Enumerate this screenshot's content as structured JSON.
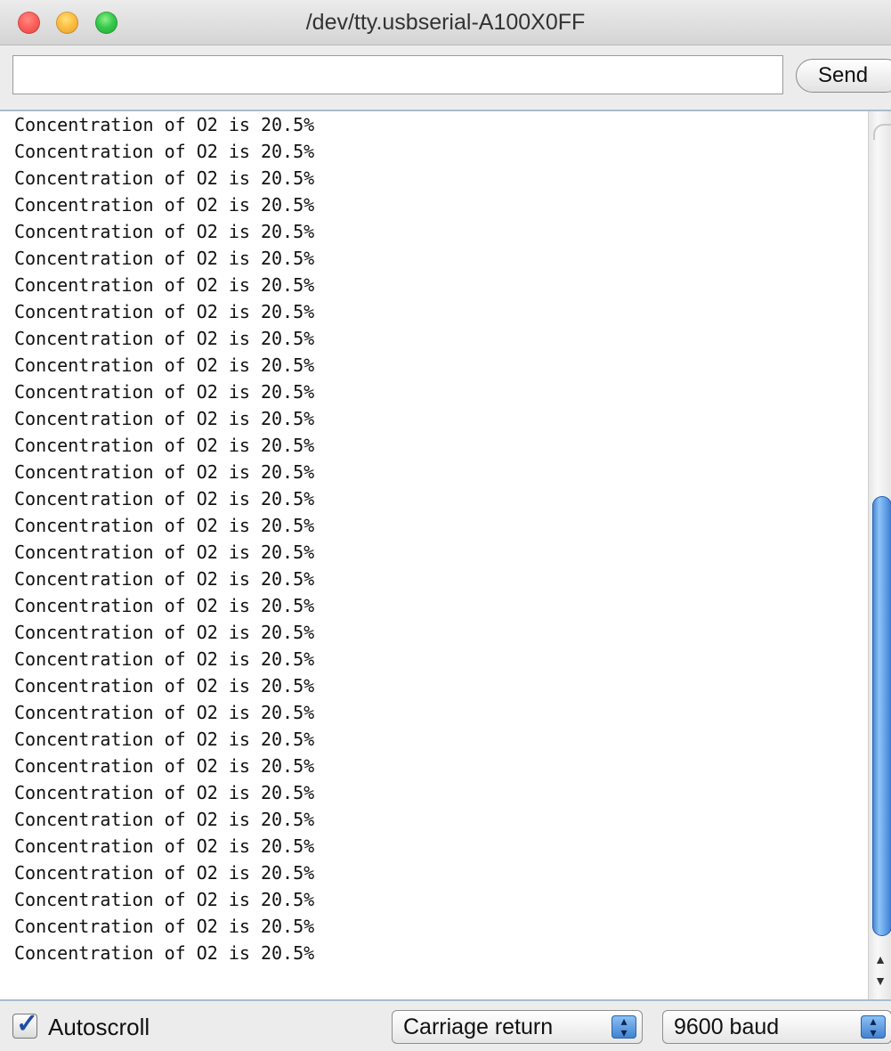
{
  "window": {
    "title": "/dev/tty.usbserial-A100X0FF"
  },
  "input_row": {
    "value": "",
    "send_label": "Send"
  },
  "output": {
    "lines": [
      "Concentration of O2 is 20.5%",
      "Concentration of O2 is 20.5%",
      "Concentration of O2 is 20.5%",
      "Concentration of O2 is 20.5%",
      "Concentration of O2 is 20.5%",
      "Concentration of O2 is 20.5%",
      "Concentration of O2 is 20.5%",
      "Concentration of O2 is 20.5%",
      "Concentration of O2 is 20.5%",
      "Concentration of O2 is 20.5%",
      "Concentration of O2 is 20.5%",
      "Concentration of O2 is 20.5%",
      "Concentration of O2 is 20.5%",
      "Concentration of O2 is 20.5%",
      "Concentration of O2 is 20.5%",
      "Concentration of O2 is 20.5%",
      "Concentration of O2 is 20.5%",
      "Concentration of O2 is 20.5%",
      "Concentration of O2 is 20.5%",
      "Concentration of O2 is 20.5%",
      "Concentration of O2 is 20.5%",
      "Concentration of O2 is 20.5%",
      "Concentration of O2 is 20.5%",
      "Concentration of O2 is 20.5%",
      "Concentration of O2 is 20.5%",
      "Concentration of O2 is 20.5%",
      "Concentration of O2 is 20.5%",
      "Concentration of O2 is 20.5%",
      "Concentration of O2 is 20.5%",
      "Concentration of O2 is 20.5%",
      "Concentration of O2 is 20.5%",
      "Concentration of O2 is 20.5%"
    ]
  },
  "bottom_bar": {
    "autoscroll_label": "Autoscroll",
    "autoscroll_checked": true,
    "line_ending_selected": "Carriage return",
    "baud_selected": "9600 baud"
  },
  "icons": {
    "stepper": "up-down-arrows",
    "check": "checkmark",
    "scroll_up": "▲",
    "scroll_down": "▼"
  },
  "colors": {
    "accent": "#3f7fd0",
    "close": "#fc605c",
    "minimize": "#fdbc40",
    "zoom": "#34c84a"
  }
}
